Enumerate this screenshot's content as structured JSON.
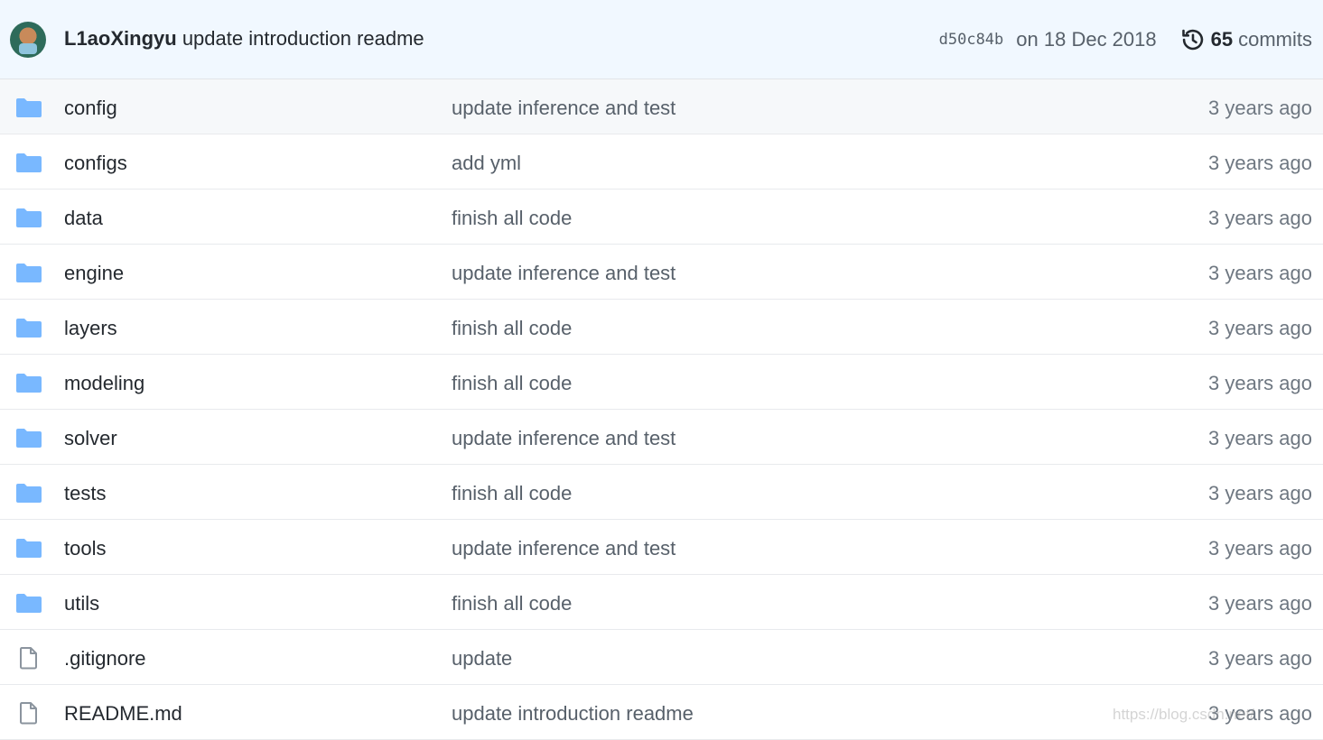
{
  "latest_commit": {
    "author": "L1aoXingyu",
    "message": "update introduction readme",
    "sha": "d50c84b",
    "date": "on 18 Dec 2018",
    "commit_count": "65",
    "commits_label": "commits"
  },
  "files": [
    {
      "name": "config",
      "type": "folder",
      "message": "update inference and test",
      "time": "3 years ago"
    },
    {
      "name": "configs",
      "type": "folder",
      "message": "add yml",
      "time": "3 years ago"
    },
    {
      "name": "data",
      "type": "folder",
      "message": "finish all code",
      "time": "3 years ago"
    },
    {
      "name": "engine",
      "type": "folder",
      "message": "update inference and test",
      "time": "3 years ago"
    },
    {
      "name": "layers",
      "type": "folder",
      "message": "finish all code",
      "time": "3 years ago"
    },
    {
      "name": "modeling",
      "type": "folder",
      "message": "finish all code",
      "time": "3 years ago"
    },
    {
      "name": "solver",
      "type": "folder",
      "message": "update inference and test",
      "time": "3 years ago"
    },
    {
      "name": "tests",
      "type": "folder",
      "message": "finish all code",
      "time": "3 years ago"
    },
    {
      "name": "tools",
      "type": "folder",
      "message": "update inference and test",
      "time": "3 years ago"
    },
    {
      "name": "utils",
      "type": "folder",
      "message": "finish all code",
      "time": "3 years ago"
    },
    {
      "name": ".gitignore",
      "type": "file",
      "message": "update",
      "time": "3 years ago"
    },
    {
      "name": "README.md",
      "type": "file",
      "message": "update introduction readme",
      "time": "3 years ago"
    }
  ],
  "watermark": "https://blog.csdn.net/",
  "colors": {
    "folder": "#79b8ff",
    "file": "#8b949e",
    "header_bg": "#f1f8ff"
  }
}
